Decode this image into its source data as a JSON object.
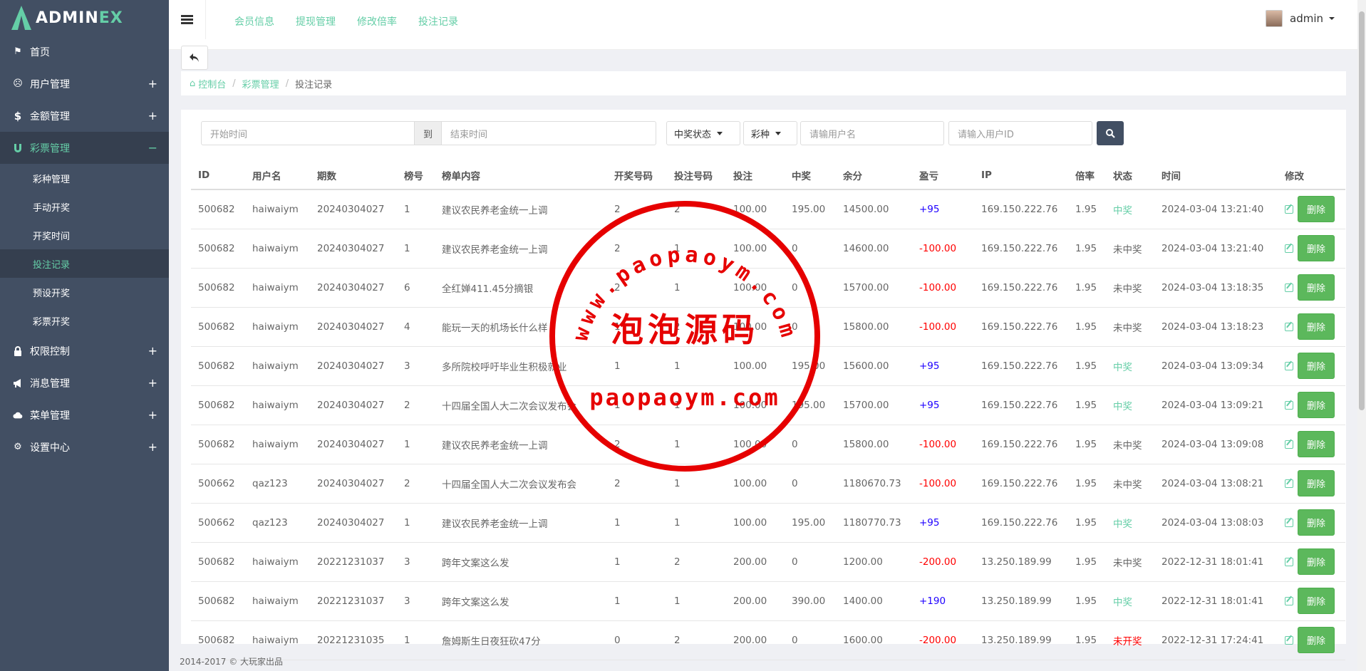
{
  "app": {
    "logo_main": "ADMIN",
    "logo_accent": "EX"
  },
  "sidebar": {
    "items": [
      {
        "label": "首页",
        "icon": "flag-icon",
        "expander": ""
      },
      {
        "label": "用户管理",
        "icon": "user-circle-icon",
        "expander": "+"
      },
      {
        "label": "金额管理",
        "icon": "dollar-icon",
        "expander": "+"
      },
      {
        "label": "彩票管理",
        "icon": "magnet-icon",
        "expander": "−"
      },
      {
        "label": "权限控制",
        "icon": "lock-icon",
        "expander": "+"
      },
      {
        "label": "消息管理",
        "icon": "bullhorn-icon",
        "expander": "+"
      },
      {
        "label": "菜单管理",
        "icon": "cloud-icon",
        "expander": "+"
      },
      {
        "label": "设置中心",
        "icon": "gear-icon",
        "expander": "+"
      }
    ],
    "sub_items": [
      "彩种管理",
      "手动开奖",
      "开奖时间",
      "投注记录",
      "预设开奖",
      "彩票开奖"
    ]
  },
  "header": {
    "nav": [
      "会员信息",
      "提现管理",
      "修改倍率",
      "投注记录"
    ],
    "user": "admin"
  },
  "breadcrumb": {
    "home": "控制台",
    "level2": "彩票管理",
    "current": "投注记录"
  },
  "filter": {
    "start_placeholder": "开始时间",
    "to_label": "到",
    "end_placeholder": "结束时间",
    "status_select": "中奖状态",
    "type_select": "彩种",
    "username_placeholder": "请输用户名",
    "userid_placeholder": "请输入用户ID"
  },
  "table": {
    "headers": [
      "ID",
      "用户名",
      "期数",
      "榜号",
      "榜单内容",
      "开奖号码",
      "投注号码",
      "投注",
      "中奖",
      "余分",
      "盈亏",
      "IP",
      "倍率",
      "状态",
      "时间",
      "修改"
    ],
    "delete_label": "删除",
    "rows": [
      {
        "id": "500682",
        "user": "haiwaiym",
        "period": "20240304027",
        "no": "1",
        "content": "建议农民养老金统一上调",
        "draw": "2",
        "bet": "2",
        "amount": "100.00",
        "win": "195.00",
        "balance": "14500.00",
        "pl": "+95",
        "ip": "169.150.222.76",
        "rate": "1.95",
        "status": "中奖",
        "status_type": "win",
        "time": "2024-03-04 13:21:40"
      },
      {
        "id": "500682",
        "user": "haiwaiym",
        "period": "20240304027",
        "no": "1",
        "content": "建议农民养老金统一上调",
        "draw": "2",
        "bet": "1",
        "amount": "100.00",
        "win": "0",
        "balance": "14600.00",
        "pl": "-100.00",
        "ip": "169.150.222.76",
        "rate": "1.95",
        "status": "未中奖",
        "status_type": "lose",
        "time": "2024-03-04 13:21:40"
      },
      {
        "id": "500682",
        "user": "haiwaiym",
        "period": "20240304027",
        "no": "6",
        "content": "全红婵411.45分摘银",
        "draw": "2",
        "bet": "1",
        "amount": "100.00",
        "win": "0",
        "balance": "15700.00",
        "pl": "-100.00",
        "ip": "169.150.222.76",
        "rate": "1.95",
        "status": "未中奖",
        "status_type": "lose",
        "time": "2024-03-04 13:18:35"
      },
      {
        "id": "500682",
        "user": "haiwaiym",
        "period": "20240304027",
        "no": "4",
        "content": "能玩一天的机场长什么样",
        "draw": "1",
        "bet": "2",
        "amount": "100.00",
        "win": "0",
        "balance": "15800.00",
        "pl": "-100.00",
        "ip": "169.150.222.76",
        "rate": "1.95",
        "status": "未中奖",
        "status_type": "lose",
        "time": "2024-03-04 13:18:23"
      },
      {
        "id": "500682",
        "user": "haiwaiym",
        "period": "20240304027",
        "no": "3",
        "content": "多所院校呼吁毕业生积极就业",
        "draw": "1",
        "bet": "1",
        "amount": "100.00",
        "win": "195.00",
        "balance": "15600.00",
        "pl": "+95",
        "ip": "169.150.222.76",
        "rate": "1.95",
        "status": "中奖",
        "status_type": "win",
        "time": "2024-03-04 13:09:34"
      },
      {
        "id": "500682",
        "user": "haiwaiym",
        "period": "20240304027",
        "no": "2",
        "content": "十四届全国人大二次会议发布会",
        "draw": "1",
        "bet": "1",
        "amount": "100.00",
        "win": "195.00",
        "balance": "15700.00",
        "pl": "+95",
        "ip": "169.150.222.76",
        "rate": "1.95",
        "status": "中奖",
        "status_type": "win",
        "time": "2024-03-04 13:09:21"
      },
      {
        "id": "500682",
        "user": "haiwaiym",
        "period": "20240304027",
        "no": "1",
        "content": "建议农民养老金统一上调",
        "draw": "2",
        "bet": "1",
        "amount": "100.00",
        "win": "0",
        "balance": "15800.00",
        "pl": "-100.00",
        "ip": "169.150.222.76",
        "rate": "1.95",
        "status": "未中奖",
        "status_type": "lose",
        "time": "2024-03-04 13:09:08"
      },
      {
        "id": "500662",
        "user": "qaz123",
        "period": "20240304027",
        "no": "2",
        "content": "十四届全国人大二次会议发布会",
        "draw": "2",
        "bet": "1",
        "amount": "100.00",
        "win": "0",
        "balance": "1180670.73",
        "pl": "-100.00",
        "ip": "169.150.222.76",
        "rate": "1.95",
        "status": "未中奖",
        "status_type": "lose",
        "time": "2024-03-04 13:08:21"
      },
      {
        "id": "500662",
        "user": "qaz123",
        "period": "20240304027",
        "no": "1",
        "content": "建议农民养老金统一上调",
        "draw": "1",
        "bet": "1",
        "amount": "100.00",
        "win": "195.00",
        "balance": "1180770.73",
        "pl": "+95",
        "ip": "169.150.222.76",
        "rate": "1.95",
        "status": "中奖",
        "status_type": "win",
        "time": "2024-03-04 13:08:03"
      },
      {
        "id": "500682",
        "user": "haiwaiym",
        "period": "20221231037",
        "no": "3",
        "content": "跨年文案这么发",
        "draw": "1",
        "bet": "2",
        "amount": "200.00",
        "win": "0",
        "balance": "1200.00",
        "pl": "-200.00",
        "ip": "13.250.189.99",
        "rate": "1.95",
        "status": "未中奖",
        "status_type": "lose",
        "time": "2022-12-31 18:01:41"
      },
      {
        "id": "500682",
        "user": "haiwaiym",
        "period": "20221231037",
        "no": "3",
        "content": "跨年文案这么发",
        "draw": "1",
        "bet": "1",
        "amount": "200.00",
        "win": "390.00",
        "balance": "1400.00",
        "pl": "+190",
        "ip": "13.250.189.99",
        "rate": "1.95",
        "status": "中奖",
        "status_type": "win",
        "time": "2022-12-31 18:01:41"
      },
      {
        "id": "500682",
        "user": "haiwaiym",
        "period": "20221231035",
        "no": "1",
        "content": "詹姆斯生日夜狂砍47分",
        "draw": "0",
        "bet": "2",
        "amount": "200.00",
        "win": "0",
        "balance": "1600.00",
        "pl": "-200.00",
        "ip": "13.250.189.99",
        "rate": "1.95",
        "status": "未开奖",
        "status_type": "none",
        "time": "2022-12-31 17:24:41"
      }
    ]
  },
  "footer": {
    "text": "2014-2017 © 大玩家出品"
  },
  "watermark": {
    "url_arc": "www.paopaoym.com",
    "title": "泡泡源码",
    "bottom": "paopaoym.com"
  },
  "colors": {
    "accent": "#65cea7",
    "sidebar": "#424f63",
    "positive": "#1e00ff",
    "negative": "#ff0000",
    "delete_btn": "#5cb85c"
  }
}
